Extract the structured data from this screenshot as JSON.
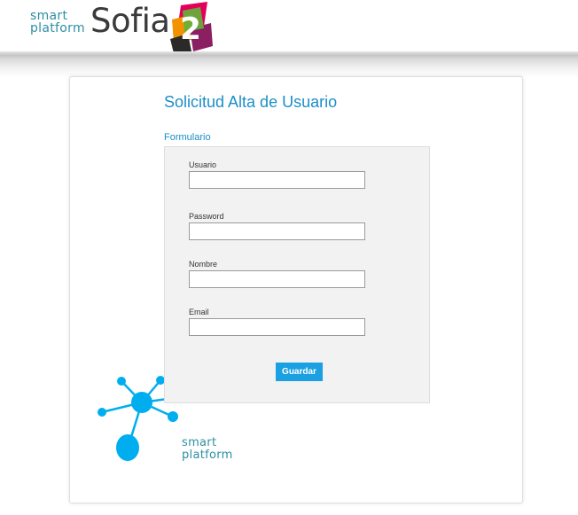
{
  "header": {
    "logo_small_line1": "smart",
    "logo_small_line2": "platform",
    "logo_text": "Sofia",
    "logo_number": "2",
    "colors": {
      "brand_teal": "#2e8fa3",
      "logo_text": "#3a3a3a"
    }
  },
  "main": {
    "title": "Solicitud Alta de Usuario",
    "section_label": "Formulario",
    "fields": [
      {
        "label": "Usuario",
        "value": ""
      },
      {
        "label": "Password",
        "value": ""
      },
      {
        "label": "Nombre",
        "value": ""
      },
      {
        "label": "Email",
        "value": ""
      }
    ],
    "submit_label": "Guardar",
    "colors": {
      "accent": "#1c8ec9",
      "button": "#1ba0e2",
      "panel": "#f2f2f2"
    }
  },
  "footer_brand": {
    "line1": "smart",
    "line2": "platform",
    "icon": "network-node-icon",
    "color": "#00aeef"
  }
}
